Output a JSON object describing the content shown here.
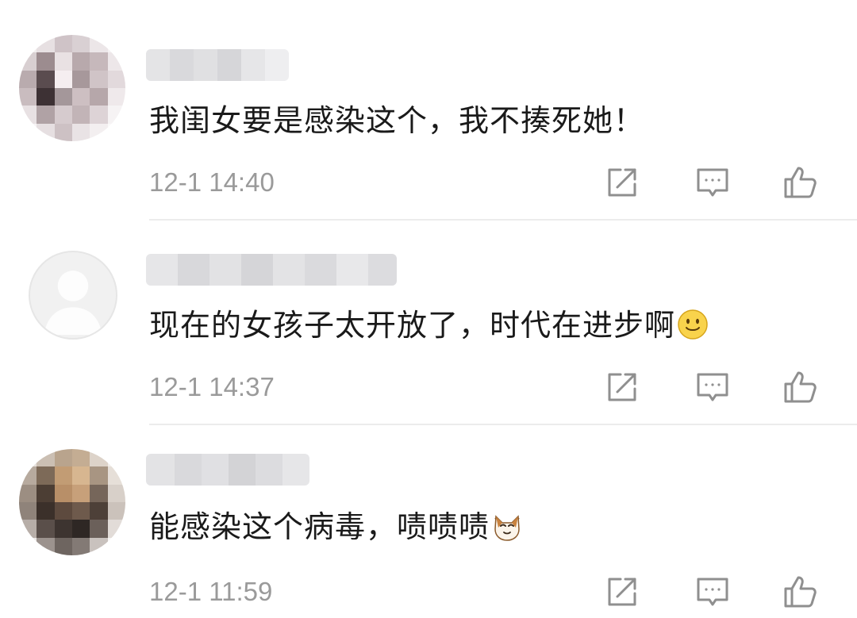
{
  "comments": [
    {
      "text": "我闺女要是感染这个，我不揍死她！",
      "time": "12-1 14:40"
    },
    {
      "text": "现在的女孩子太开放了，时代在进步啊",
      "time": "12-1 14:37",
      "emoji": "smile-emoji"
    },
    {
      "text": "能感染这个病毒，啧啧啧",
      "time": "12-1 11:59",
      "emoji": "cat-emoji"
    }
  ],
  "icons": {
    "repost": "repost-icon",
    "comment": "comment-icon",
    "like": "thumbs-up-icon"
  },
  "colors": {
    "text": "#1a1a1a",
    "meta": "#9a9a9a",
    "icon": "#8f8f8f",
    "divider": "#ececec"
  }
}
